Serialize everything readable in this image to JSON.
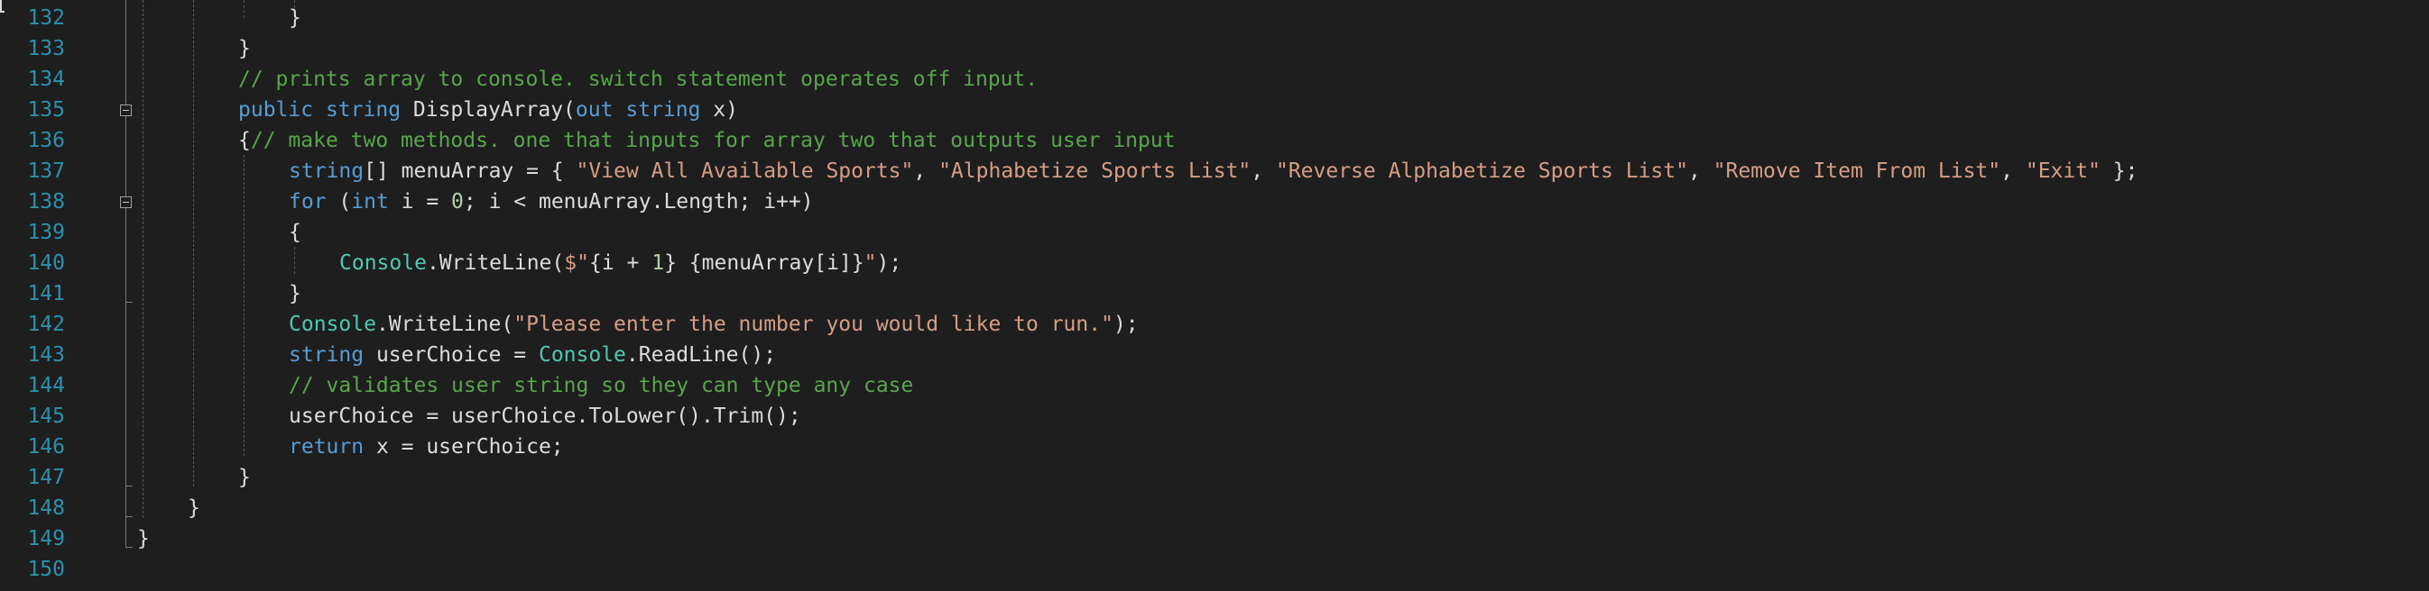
{
  "line_numbers": [
    "132",
    "133",
    "134",
    "135",
    "136",
    "137",
    "138",
    "139",
    "140",
    "141",
    "142",
    "143",
    "144",
    "145",
    "146",
    "147",
    "148",
    "149",
    "150"
  ],
  "lines": [
    [
      [
        "pl",
        "}"
      ]
    ],
    [
      [
        "pl",
        "}"
      ]
    ],
    [
      [
        "cm",
        "// prints array to console. switch statement operates off input."
      ]
    ],
    [
      [
        "kw",
        "public"
      ],
      [
        "pl",
        " "
      ],
      [
        "kw",
        "string"
      ],
      [
        "pl",
        " DisplayArray("
      ],
      [
        "kw",
        "out"
      ],
      [
        "pl",
        " "
      ],
      [
        "kw",
        "string"
      ],
      [
        "pl",
        " x)"
      ]
    ],
    [
      [
        "pl",
        "{"
      ],
      [
        "cm",
        "// make two methods. one that inputs for array two that outputs user input"
      ]
    ],
    [
      [
        "kw",
        "string"
      ],
      [
        "pl",
        "[] menuArray = { "
      ],
      [
        "st",
        "\"View All Available Sports\""
      ],
      [
        "pl",
        ", "
      ],
      [
        "st",
        "\"Alphabetize Sports List\""
      ],
      [
        "pl",
        ", "
      ],
      [
        "st",
        "\"Reverse Alphabetize Sports List\""
      ],
      [
        "pl",
        ", "
      ],
      [
        "st",
        "\"Remove Item From List\""
      ],
      [
        "pl",
        ", "
      ],
      [
        "st",
        "\"Exit\""
      ],
      [
        "pl",
        " };"
      ]
    ],
    [
      [
        "kw",
        "for"
      ],
      [
        "pl",
        " ("
      ],
      [
        "kw",
        "int"
      ],
      [
        "pl",
        " i = "
      ],
      [
        "nu",
        "0"
      ],
      [
        "pl",
        "; i < menuArray.Length; i++)"
      ]
    ],
    [
      [
        "pl",
        "{"
      ]
    ],
    [
      [
        "ty",
        "Console"
      ],
      [
        "pl",
        ".WriteLine("
      ],
      [
        "st",
        "$\""
      ],
      [
        "pl",
        "{i + "
      ],
      [
        "nu",
        "1"
      ],
      [
        "pl",
        "} {menuArray[i]}"
      ],
      [
        "st",
        "\""
      ],
      [
        "pl",
        ");"
      ]
    ],
    [
      [
        "pl",
        "}"
      ]
    ],
    [
      [
        "ty",
        "Console"
      ],
      [
        "pl",
        ".WriteLine("
      ],
      [
        "st",
        "\"Please enter the number you would like to run.\""
      ],
      [
        "pl",
        ");"
      ]
    ],
    [
      [
        "kw",
        "string"
      ],
      [
        "pl",
        " userChoice = "
      ],
      [
        "ty",
        "Console"
      ],
      [
        "pl",
        ".ReadLine();"
      ]
    ],
    [
      [
        "cm",
        "// validates user string so they can type any case"
      ]
    ],
    [
      [
        "pl",
        "userChoice = userChoice.ToLower().Trim();"
      ]
    ],
    [
      [
        "kw",
        "return"
      ],
      [
        "pl",
        " x = userChoice;"
      ]
    ],
    [
      [
        "pl",
        "}"
      ]
    ],
    [
      [
        "pl",
        "}"
      ]
    ],
    [
      [
        "pl",
        "}"
      ]
    ],
    []
  ]
}
